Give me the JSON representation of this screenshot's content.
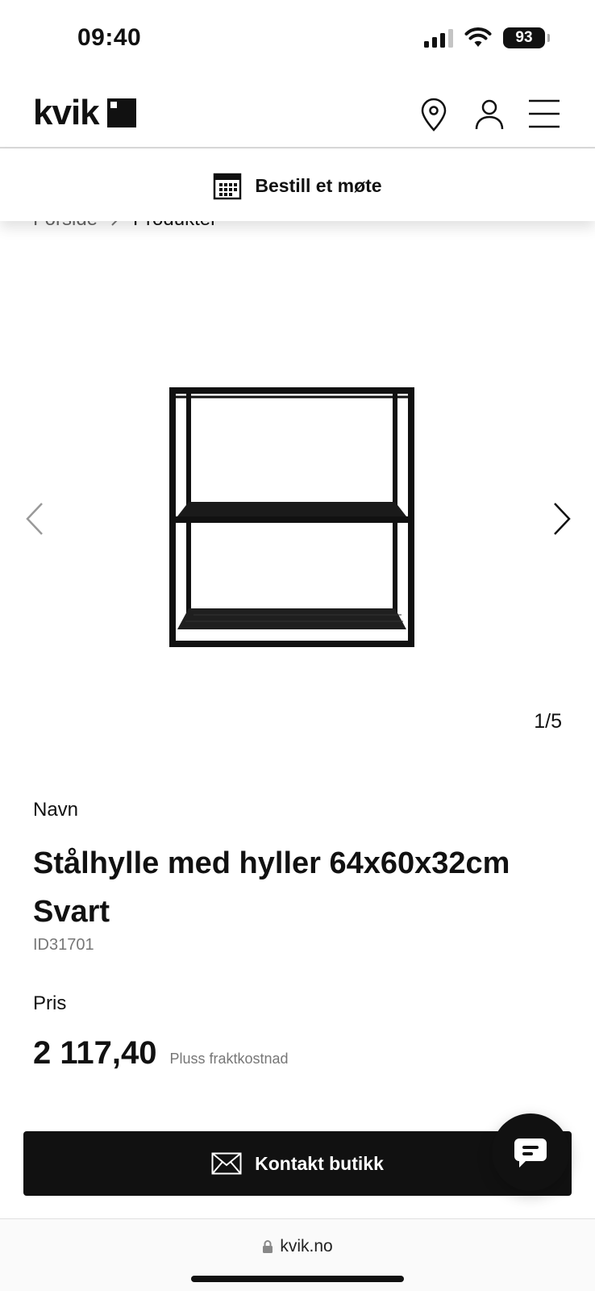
{
  "status_bar": {
    "time": "09:40",
    "battery": "93"
  },
  "header": {
    "logo_text": "kvik"
  },
  "meeting": {
    "label": "Bestill et møte"
  },
  "breadcrumb": {
    "items": [
      "Forside",
      "Produkter"
    ]
  },
  "gallery": {
    "counter": "1/5"
  },
  "product": {
    "name_label": "Navn",
    "title": "Stålhylle med hyller 64x60x32cm Svart",
    "id": "ID31701",
    "price_label": "Pris",
    "price": "2 117,40",
    "shipping_note": "Pluss fraktkostnad"
  },
  "actions": {
    "contact_label": "Kontakt butikk"
  },
  "browser": {
    "url": "kvik.no"
  },
  "icons": [
    "map-pin-icon",
    "user-icon",
    "menu-icon",
    "calendar-icon",
    "chevron-left-icon",
    "chevron-right-icon",
    "envelope-icon",
    "chat-icon",
    "lock-icon"
  ]
}
